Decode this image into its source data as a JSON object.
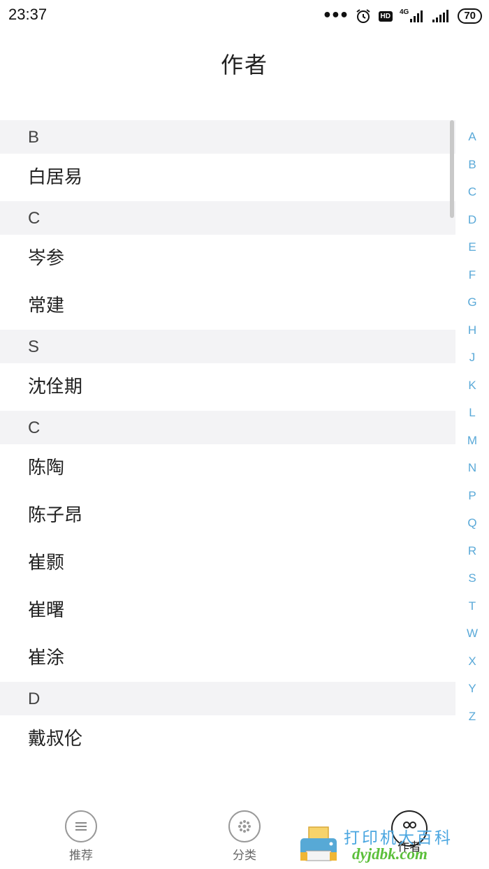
{
  "status_bar": {
    "time": "23:37",
    "hd_badge": "HD",
    "network_label": "4G",
    "battery": "70",
    "icons": [
      "more-dots-icon",
      "alarm-icon",
      "hd-icon",
      "signal-4g-icon",
      "signal-icon",
      "battery-icon"
    ]
  },
  "title": "作者",
  "sections": [
    {
      "letter": "B",
      "authors": [
        "白居易"
      ]
    },
    {
      "letter": "C",
      "authors": [
        "岑参",
        "常建"
      ]
    },
    {
      "letter": "S",
      "authors": [
        "沈佺期"
      ]
    },
    {
      "letter": "C",
      "authors": [
        "陈陶",
        "陈子昂",
        "崔颢",
        "崔曙",
        "崔涂"
      ]
    },
    {
      "letter": "D",
      "authors": [
        "戴叔伦"
      ]
    }
  ],
  "alpha_index": [
    "A",
    "B",
    "C",
    "D",
    "E",
    "F",
    "G",
    "H",
    "J",
    "K",
    "L",
    "M",
    "N",
    "P",
    "Q",
    "R",
    "S",
    "T",
    "W",
    "X",
    "Y",
    "Z"
  ],
  "accent_color": "#5aa9d8",
  "tabs": [
    {
      "label": "推荐",
      "icon": "list-icon"
    },
    {
      "label": "分类",
      "icon": "flower-icon"
    },
    {
      "label": "作者",
      "icon": "author-icon",
      "active": true
    }
  ],
  "watermark": {
    "top": "打印机大百科",
    "bottom": "dyjdbk.com"
  }
}
